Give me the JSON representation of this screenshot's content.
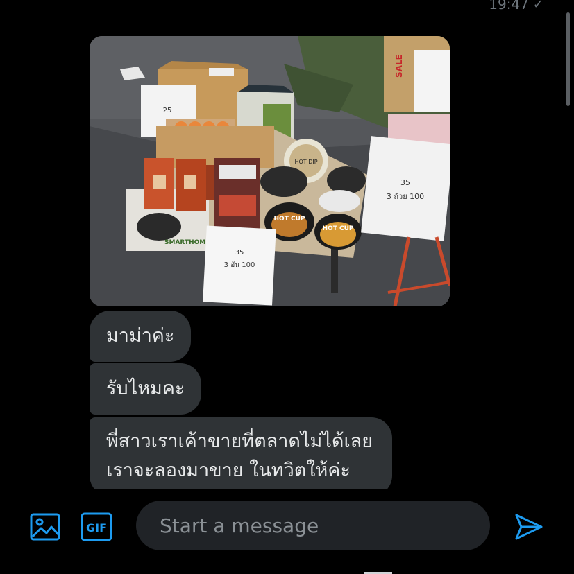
{
  "header": {
    "time": "19:47",
    "check_glyph": "✓"
  },
  "photo": {
    "sign_left": [
      "35",
      "3 อัน 100"
    ],
    "sign_right": [
      "35",
      "3 ถ้วย 100"
    ],
    "hot_cup_label": "HOT CUP",
    "smarthome_label": "SMARTHOME",
    "box_sign": "25",
    "sale_label": "SALE",
    "hot_dip_label": "HOT DIP"
  },
  "messages": [
    {
      "lines": [
        "มาม่าค่ะ"
      ]
    },
    {
      "lines": [
        "รับไหมคะ"
      ]
    },
    {
      "lines": [
        "พี่สาวเราเค้าขายที่ตลาดไม่ได้เลย",
        "เราจะลองมาขาย ในทวิตให้ค่ะ"
      ]
    }
  ],
  "composer": {
    "placeholder": "Start a message",
    "gif_label": "GIF",
    "accent_color": "#1d9bf0",
    "icons": [
      "image-icon",
      "gif-icon",
      "send-icon"
    ]
  }
}
